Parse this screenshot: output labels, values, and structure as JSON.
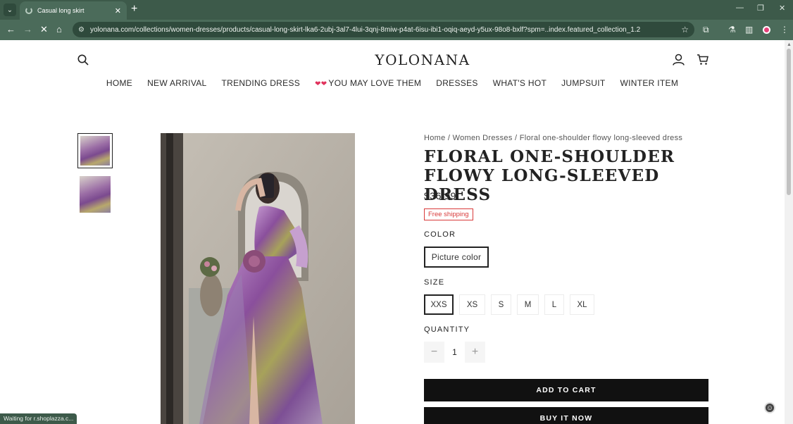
{
  "browser": {
    "tab_title": "Casual long skirt",
    "url": "yolonana.com/collections/women-dresses/products/casual-long-skirt-lka6-2ubj-3al7-4lui-3qnj-8miw-p4at-6isu-ibi1-oqiq-aeyd-y5ux-98o8-bxlf?spm=..index.featured_collection_1.2",
    "status_text": "Waiting for r.shoplazza.c...",
    "colors": {
      "frame": "#3d5a4a",
      "toolbar": "#4b6b5a"
    }
  },
  "header": {
    "logo": "YOLONANA",
    "menu": [
      "HOME",
      "NEW ARRIVAL",
      "TRENDING DRESS",
      "YOU MAY LOVE THEM",
      "DRESSES",
      "WHAT'S HOT",
      "JUMPSUIT",
      "WINTER ITEM"
    ],
    "menu_hearts": "❤❤"
  },
  "product": {
    "breadcrumb": [
      "Home",
      "Women Dresses",
      "Floral one-shoulder flowy long-sleeved dress"
    ],
    "breadcrumb_sep": "/",
    "title": "FLORAL ONE-SHOULDER FLOWY LONG-SLEEVED DRESS",
    "price": "$36.99",
    "shipping_badge": "Free shipping",
    "color_label": "COLOR",
    "color_selected": "Picture color",
    "size_label": "SIZE",
    "sizes": [
      "XXS",
      "XS",
      "S",
      "M",
      "L",
      "XL"
    ],
    "size_selected": "XXS",
    "quantity_label": "QUANTITY",
    "quantity_minus": "−",
    "quantity_value": "1",
    "quantity_plus": "+",
    "add_to_cart": "ADD TO CART",
    "buy_now": "BUY IT NOW"
  }
}
